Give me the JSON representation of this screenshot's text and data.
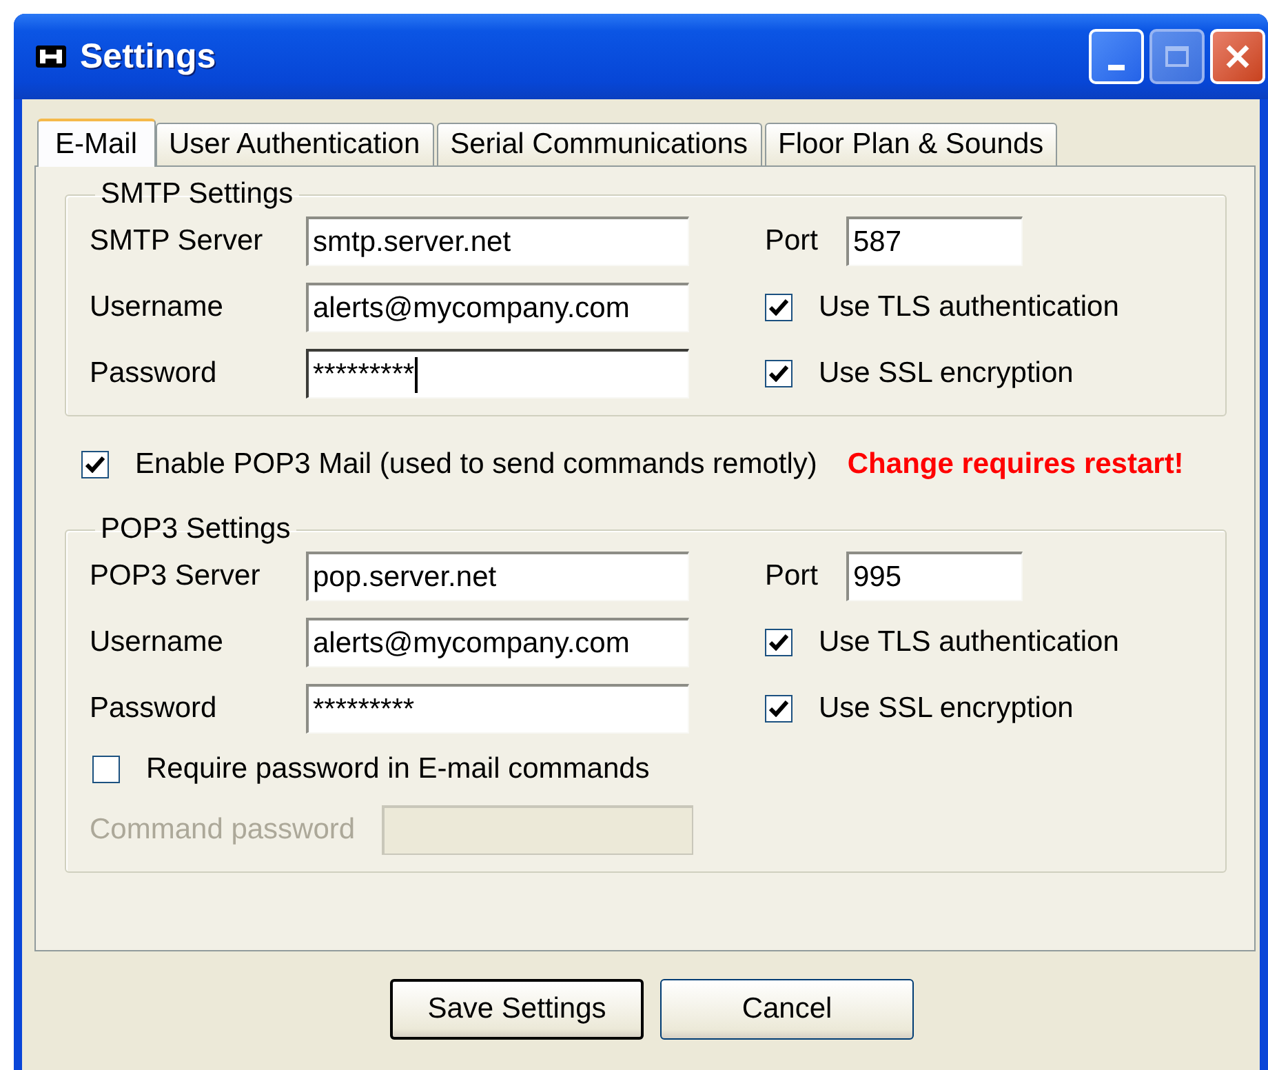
{
  "window": {
    "title": "Settings"
  },
  "tabs": [
    {
      "label": "E-Mail",
      "selected": true
    },
    {
      "label": "User Authentication",
      "selected": false
    },
    {
      "label": "Serial Communications",
      "selected": false
    },
    {
      "label": "Floor Plan & Sounds",
      "selected": false
    }
  ],
  "smtp": {
    "legend": "SMTP Settings",
    "fields": [
      {
        "label": "SMTP Server",
        "value": "smtp.server.net",
        "focused": false
      },
      {
        "label": "Username",
        "value": "alerts@mycompany.com",
        "focused": false
      },
      {
        "label": "Password",
        "value": "*********",
        "focused": true
      }
    ],
    "port": {
      "label": "Port",
      "value": "587"
    },
    "options": [
      {
        "label": "Use TLS authentication",
        "checked": true
      },
      {
        "label": "Use SSL encryption",
        "checked": true
      }
    ]
  },
  "enable_pop3": {
    "label": "Enable POP3 Mail (used to send commands remotly)",
    "checked": true
  },
  "restart_warning": "Change requires restart!",
  "pop3": {
    "legend": "POP3 Settings",
    "fields": [
      {
        "label": "POP3 Server",
        "value": "pop.server.net",
        "focused": false
      },
      {
        "label": "Username",
        "value": "alerts@mycompany.com",
        "focused": false
      },
      {
        "label": "Password",
        "value": "*********",
        "focused": false
      }
    ],
    "port": {
      "label": "Port",
      "value": "995"
    },
    "options": [
      {
        "label": "Use TLS authentication",
        "checked": true
      },
      {
        "label": "Use SSL encryption",
        "checked": true
      }
    ]
  },
  "require_password": {
    "label": "Require password in E-mail commands",
    "checked": false
  },
  "command_password": {
    "label": "Command password",
    "disabled": true
  },
  "buttons": [
    {
      "label": "Save Settings",
      "default": true
    },
    {
      "label": "Cancel",
      "default": false
    }
  ]
}
